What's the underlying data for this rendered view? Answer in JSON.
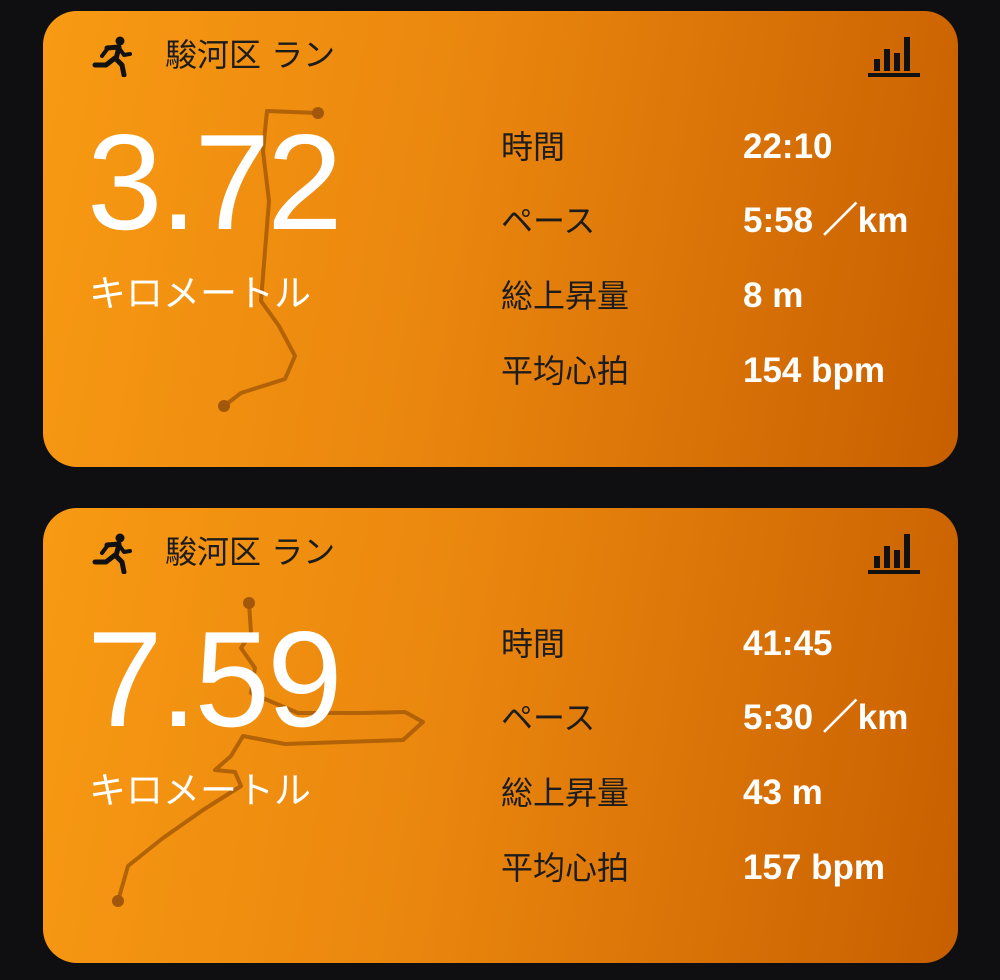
{
  "cards": [
    {
      "title": "駿河区 ラン",
      "activity_icon": "running-person-icon",
      "chart_icon": "bar-chart-icon",
      "distance": "3.72",
      "unit": "キロメートル",
      "stats": [
        {
          "label": "時間",
          "value": "22:10"
        },
        {
          "label": "ペース",
          "value": "5:58 ／km"
        },
        {
          "label": "総上昇量",
          "value": "8 m"
        },
        {
          "label": "平均心拍",
          "value": "154 bpm"
        }
      ]
    },
    {
      "title": "駿河区 ラン",
      "activity_icon": "running-person-icon",
      "chart_icon": "bar-chart-icon",
      "distance": "7.59",
      "unit": "キロメートル",
      "stats": [
        {
          "label": "時間",
          "value": "41:45"
        },
        {
          "label": "ペース",
          "value": "5:30 ／km"
        },
        {
          "label": "総上昇量",
          "value": "43 m"
        },
        {
          "label": "平均心拍",
          "value": "157 bpm"
        }
      ]
    }
  ],
  "colors": {
    "background": "#0f0f11",
    "card_gradient_start": "#f89a13",
    "card_gradient_end": "#c85f00",
    "route": "#a75a06",
    "label_text": "#1c1c1c",
    "value_text": "#ffffff"
  }
}
